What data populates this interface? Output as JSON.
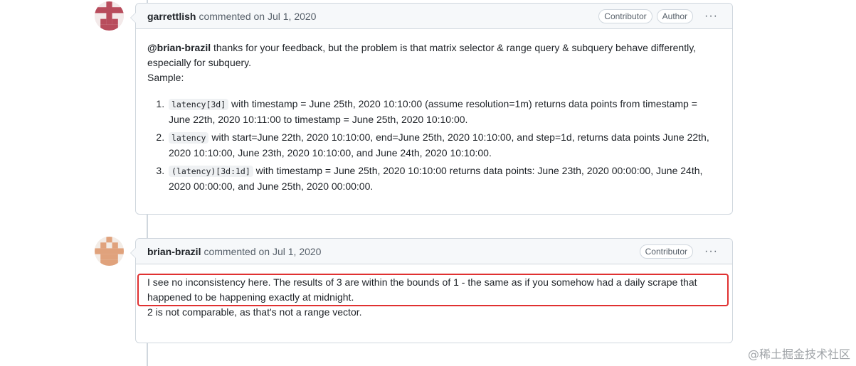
{
  "comments": [
    {
      "author": "garrettlish",
      "meta": "commented on Jul 1, 2020",
      "badges": [
        "Contributor",
        "Author"
      ],
      "mention": "@brian-brazil",
      "intro": " thanks for your feedback, but the problem is that matrix selector & range query & subquery behave differently, especially for subquery.",
      "sample": "Sample:",
      "items": [
        {
          "code": "latency[3d]",
          "text": " with timestamp = June 25th, 2020 10:10:00 (assume resolution=1m) returns data points from timestamp = June 22th, 2020 10:11:00 to timestamp = June 25th, 2020 10:10:00."
        },
        {
          "code": "latency",
          "text": " with start=June 22th, 2020 10:10:00, end=June 25th, 2020 10:10:00, and step=1d, returns data points June 22th, 2020 10:10:00, June 23th, 2020 10:10:00, and June 24th, 2020 10:10:00."
        },
        {
          "code": "(latency)[3d:1d]",
          "text": " with timestamp = June 25th, 2020 10:10:00 returns data points: June 23th, 2020 00:00:00, June 24th, 2020 00:00:00, and June 25th, 2020 00:00:00."
        }
      ]
    },
    {
      "author": "brian-brazil",
      "meta": "commented on Jul 1, 2020",
      "badges": [
        "Contributor"
      ],
      "line1": "I see no inconsistency here. The results of 3 are within the bounds of 1 - the same as if you somehow had a daily scrape that happened to be happening exactly at midnight.",
      "line2": "2 is not comparable, as that's not a range vector."
    }
  ],
  "kebab_glyph": "···",
  "watermark": "@稀土掘金技术社区",
  "colors": {
    "highlight": "#e03131",
    "border": "#d0d7de",
    "header_bg": "#f6f8fa"
  },
  "icons": [
    "identicon-avatar",
    "kebab-menu-icon"
  ]
}
